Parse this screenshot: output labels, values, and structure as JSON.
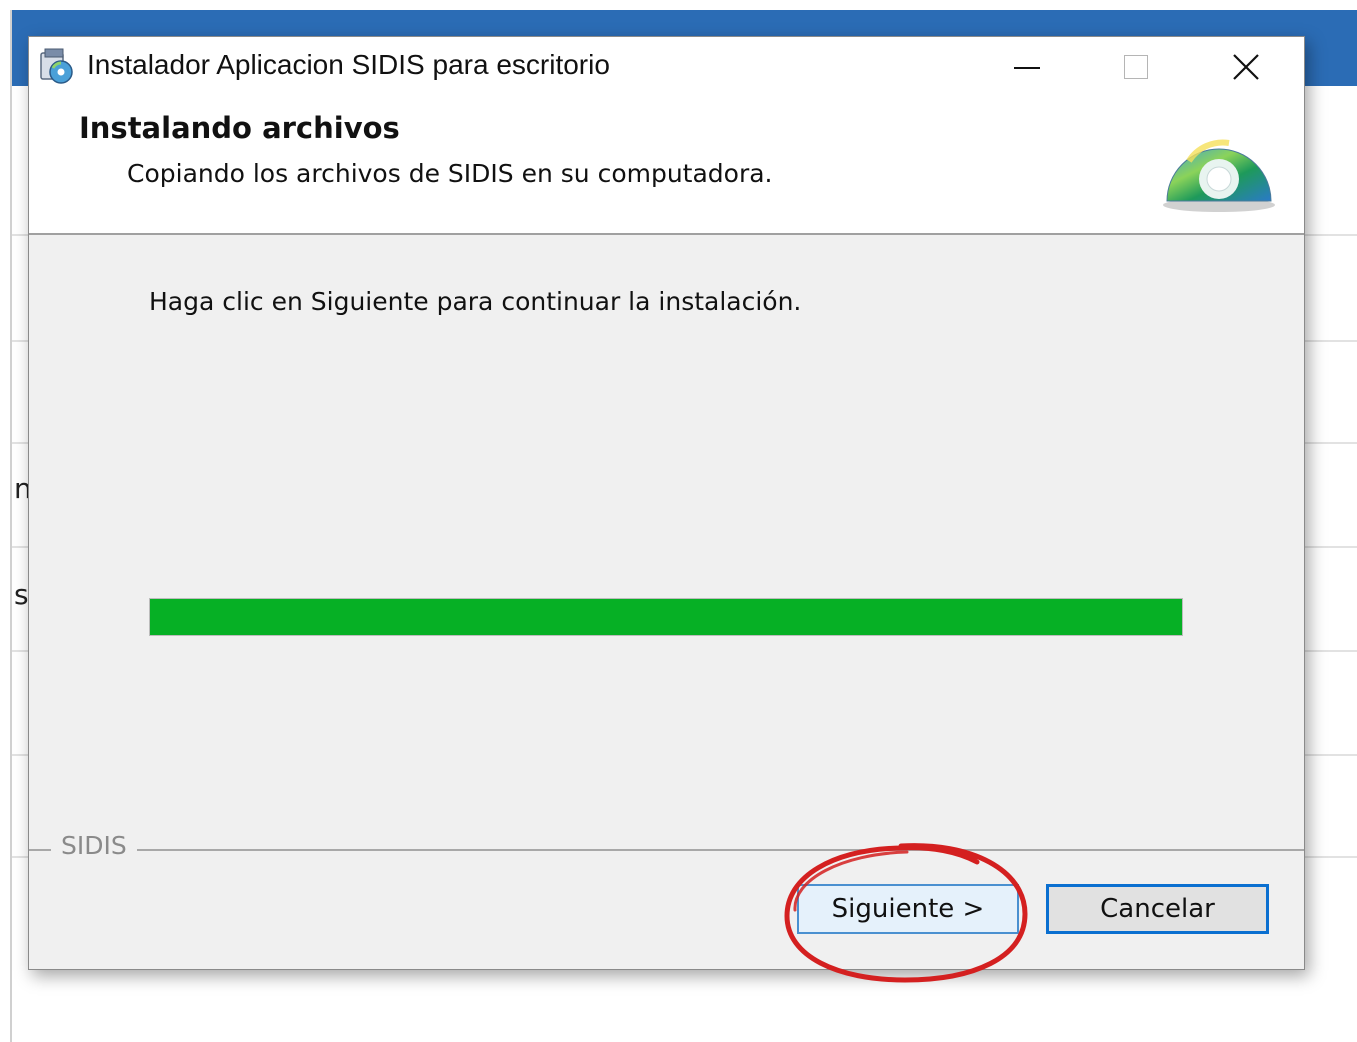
{
  "window": {
    "title": "Instalador Aplicacion SIDIS para escritorio",
    "title_icon": "installer-icon",
    "controls": {
      "minimize_icon": "minimize-icon",
      "maximize_icon": "maximize-icon",
      "close_icon": "close-icon"
    }
  },
  "header": {
    "title": "Instalando archivos",
    "subtitle": "Copiando los archivos de SIDIS en su computadora.",
    "image_icon": "cd-disc-icon"
  },
  "body": {
    "message": "Haga clic en Siguiente para continuar la instalación.",
    "progress_percent": 100
  },
  "footer": {
    "brand_label": "SIDIS",
    "next_label": "Siguiente >",
    "cancel_label": "Cancelar"
  },
  "background": {
    "fragment_1": "n",
    "fragment_2": "s"
  },
  "colors": {
    "progress_fill": "#06b025",
    "annotation": "#d42020",
    "background_titlebar": "#2b6cb5",
    "focus_border": "#0a6fd0"
  }
}
